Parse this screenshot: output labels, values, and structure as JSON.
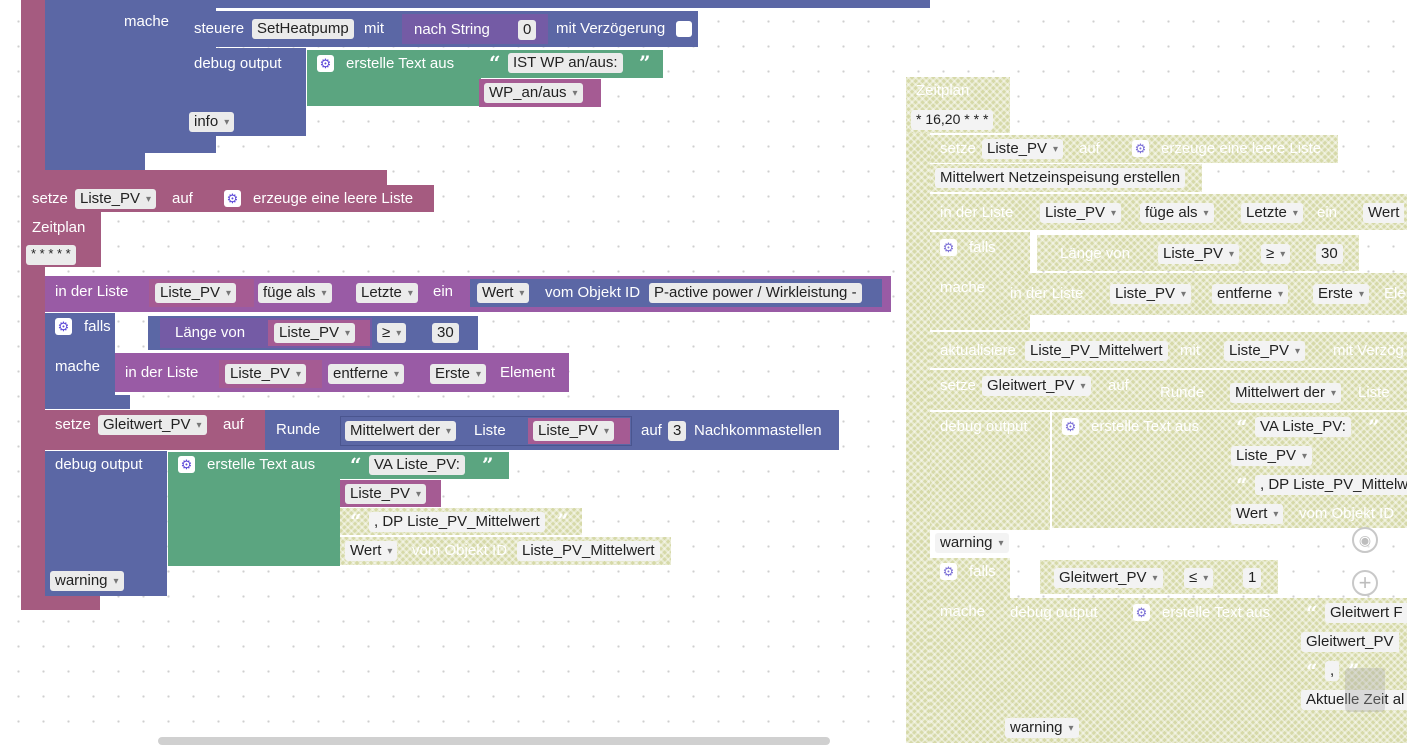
{
  "colors": {
    "event": "#a55b80",
    "logic": "#5b67a5",
    "text": "#5ba580",
    "list": "#745ba5",
    "variable": "#a55b93",
    "disabled": "#d6d9a8"
  },
  "top": {
    "mache": "mache",
    "steuere": "steuere",
    "setheatpump": "SetHeatpump",
    "mit": "mit",
    "nach_string": "nach String",
    "zero": "0",
    "mit_verzoegerung": "mit Verzögerung",
    "debug_output": "debug output",
    "erstelle_text_aus": "erstelle Text aus",
    "ist_wp": "IST WP an/aus:",
    "wp_an_aus": "WP_an/aus",
    "info": "info"
  },
  "left": {
    "setze": "setze",
    "liste_pv": "Liste_PV",
    "auf": "auf",
    "erzeuge_leere_liste": "erzeuge eine leere Liste",
    "zeitplan": "Zeitplan",
    "cron": "* * * * *",
    "in_der_liste": "in der Liste",
    "fuege_als": "füge als",
    "letzte": "Letzte",
    "ein": "ein",
    "wert": "Wert",
    "vom_objekt_id": "vom Objekt ID",
    "p_active": "P-active power / Wirkleistung -",
    "falls": "falls",
    "laenge_von": "Länge von",
    "gte": "≥",
    "thirty": "30",
    "mache": "mache",
    "entferne": "entferne",
    "erste": "Erste",
    "element": "Element",
    "gleitwert_pv": "Gleitwert_PV",
    "runde": "Runde",
    "mittelwert_der": "Mittelwert der",
    "liste": "Liste",
    "auf_nach": "auf",
    "three": "3",
    "nachkommastellen": "Nachkommastellen",
    "debug_output": "debug output",
    "erstelle_text_aus": "erstelle Text aus",
    "va_liste_pv": "VA Liste_PV:",
    "dp_mittelwert": ", DP Liste_PV_Mittelwert",
    "wert2": "Wert",
    "vom_objekt_id2": "vom Objekt ID",
    "liste_pv_mittelwert": "Liste_PV_Mittelwert",
    "warning": "warning"
  },
  "right": {
    "zeitplan": "Zeitplan",
    "cron": "* 16,20 * * *",
    "setze": "setze",
    "liste_pv": "Liste_PV",
    "auf": "auf",
    "erzeuge_leere_liste": "erzeuge eine leere Liste",
    "comment": "Mittelwert Netzeinspeisung erstellen",
    "in_der_liste": "in der Liste",
    "fuege_als": "füge als",
    "letzte": "Letzte",
    "ein": "ein",
    "wert": "Wert",
    "falls": "falls",
    "laenge_von": "Länge von",
    "gte": "≥",
    "thirty": "30",
    "mache": "mache",
    "in_der_liste2": "in der Liste",
    "entferne": "entferne",
    "erste": "Erste",
    "ele": "Ele",
    "aktualisiere": "aktualisiere",
    "liste_pv_mittelwert": "Liste_PV_Mittelwert",
    "mit": "mit",
    "mit_verzoeg": "mit Verzög",
    "gleitwert_pv": "Gleitwert_PV",
    "runde": "Runde",
    "mittelwert_der": "Mittelwert der",
    "liste": "Liste",
    "debug_output": "debug output",
    "erstelle_text_aus": "erstelle Text aus",
    "va_liste_pv": "VA Liste_PV:",
    "dp_mittelw": ", DP Liste_PV_Mittelw",
    "vom_objekt_id": "vom Objekt ID",
    "warning": "warning",
    "lte": "≤",
    "one": "1",
    "falls2": "falls",
    "mache2": "mache",
    "debug_output2": "debug output",
    "erstelle_text_aus2": "erstelle Text aus",
    "gleitwert_f": "Gleitwert F",
    "gleitwert_pv2": "Gleitwert_PV",
    "comma": ",",
    "aktuelle_zeit": "Aktuelle Zeit al",
    "warning2": "warning"
  },
  "icons": {
    "settings": "gear-icon",
    "quote_open": "quote-open-icon",
    "quote_close": "quote-close-icon",
    "target": "target-icon",
    "zoom_in": "zoom-in-icon",
    "zoom_out": "zoom-out-icon"
  }
}
